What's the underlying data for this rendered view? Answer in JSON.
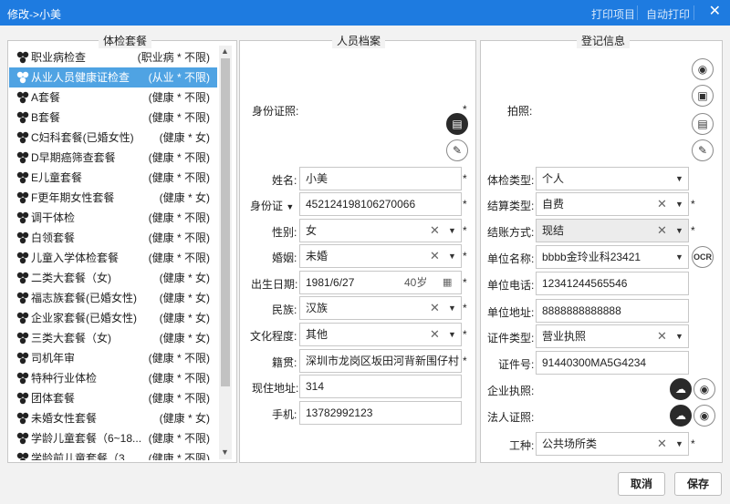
{
  "window": {
    "title": "修改->小美",
    "print_item": "打印项目",
    "auto_print": "自动打印",
    "close": "✕"
  },
  "packages": {
    "title": "体检套餐",
    "items": [
      {
        "name": "职业病检查",
        "tag": "(职业病 * 不限)"
      },
      {
        "name": "从业人员健康证检查",
        "tag": "(从业 * 不限)"
      },
      {
        "name": "A套餐",
        "tag": "(健康 * 不限)"
      },
      {
        "name": "B套餐",
        "tag": "(健康 * 不限)"
      },
      {
        "name": "C妇科套餐(已婚女性)",
        "tag": "(健康 * 女)"
      },
      {
        "name": "D早期癌筛查套餐",
        "tag": "(健康 * 不限)"
      },
      {
        "name": "E儿童套餐",
        "tag": "(健康 * 不限)"
      },
      {
        "name": "F更年期女性套餐",
        "tag": "(健康 * 女)"
      },
      {
        "name": "调干体检",
        "tag": "(健康 * 不限)"
      },
      {
        "name": "白领套餐",
        "tag": "(健康 * 不限)"
      },
      {
        "name": "儿童入学体检套餐",
        "tag": "(健康 * 不限)"
      },
      {
        "name": "二类大套餐（女)",
        "tag": "(健康 * 女)"
      },
      {
        "name": "福志族套餐(已婚女性)",
        "tag": "(健康 * 女)"
      },
      {
        "name": "企业家套餐(已婚女性)",
        "tag": "(健康 * 女)"
      },
      {
        "name": "三类大套餐（女)",
        "tag": "(健康 * 女)"
      },
      {
        "name": "司机年审",
        "tag": "(健康 * 不限)"
      },
      {
        "name": "特种行业体检",
        "tag": "(健康 * 不限)"
      },
      {
        "name": "团体套餐",
        "tag": "(健康 * 不限)"
      },
      {
        "name": "未婚女性套餐",
        "tag": "(健康 * 女)"
      },
      {
        "name": "学龄儿童套餐（6~18...",
        "tag": "(健康 * 不限)"
      },
      {
        "name": "学龄前儿童套餐（3...",
        "tag": "(健康 * 不限)"
      }
    ]
  },
  "person": {
    "title": "人员档案",
    "id_photo_label": "身份证照:",
    "name_label": "姓名:",
    "name": "小美",
    "idtype_label": "身份证",
    "idnum": "452124198106270066",
    "gender_label": "性别:",
    "gender": "女",
    "marriage_label": "婚姻:",
    "marriage": "未婚",
    "birth_label": "出生日期:",
    "birth": "1981/6/27",
    "age": "40岁",
    "ethnic_label": "民族:",
    "ethnic": "汉族",
    "edu_label": "文化程度:",
    "edu": "其他",
    "origin_label": "籍贯:",
    "origin": "深圳市龙岗区坂田河背新围仔村",
    "addr_label": "现住地址:",
    "addr": "314",
    "phone_label": "手机:",
    "phone": "13782992123"
  },
  "reg": {
    "title": "登记信息",
    "photo_label": "拍照:",
    "exam_type_label": "体检类型:",
    "exam_type": "个人",
    "settle_type_label": "结算类型:",
    "settle_type": "自费",
    "settle_mode_label": "结账方式:",
    "settle_mode": "现结",
    "company_label": "单位名称:",
    "company": "bbbb金玲业科23421",
    "cphone_label": "单位电话:",
    "cphone": "12341244565546",
    "caddr_label": "单位地址:",
    "caddr": "8888888888888",
    "cert_type_label": "证件类型:",
    "cert_type": "营业执照",
    "cert_no_label": "证件号:",
    "cert_no": "91440300MA5G4234",
    "license_label": "企业执照:",
    "legal_label": "法人证照:",
    "job_label": "工种:",
    "job": "公共场所类",
    "ocr": "OCR"
  },
  "buttons": {
    "cancel": "取消",
    "save": "保存"
  }
}
